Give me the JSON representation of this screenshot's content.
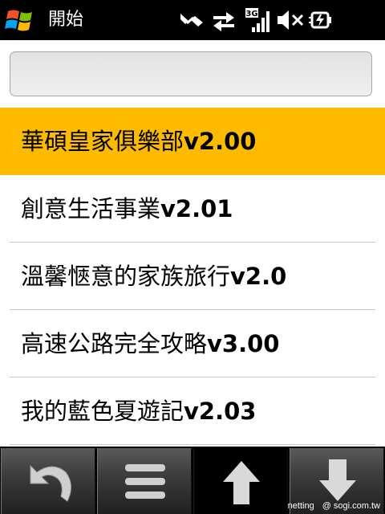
{
  "statusbar": {
    "title": "開始",
    "icons": [
      "windows-start-logo",
      "data-sync-icon",
      "connection-arrows-icon",
      "3g-signal-icon",
      "speaker-muted-icon",
      "battery-charging-icon"
    ],
    "signal_label": "3G"
  },
  "search": {
    "value": "",
    "placeholder": ""
  },
  "list": {
    "items": [
      {
        "name": "華碩皇家俱樂部",
        "version": "v2.00",
        "selected": true
      },
      {
        "name": "創意生活事業",
        "version": "v2.01",
        "selected": false
      },
      {
        "name": "溫馨愜意的家族旅行",
        "version": "v2.0",
        "selected": false
      },
      {
        "name": "高速公路完全攻略",
        "version": "v3.00",
        "selected": false
      },
      {
        "name": "我的藍色夏遊記",
        "version": "v2.03",
        "selected": false
      }
    ]
  },
  "softkeys": [
    {
      "icon": "back-arrow-icon"
    },
    {
      "icon": "menu-icon"
    },
    {
      "icon": "arrow-up-icon"
    },
    {
      "icon": "arrow-down-icon"
    }
  ],
  "watermark": {
    "author": "netting",
    "site": "@ sogi.com.tw"
  },
  "colors": {
    "selection": "#fdbb00",
    "statusbar": "#000000",
    "divider": "#c9c9c9"
  }
}
